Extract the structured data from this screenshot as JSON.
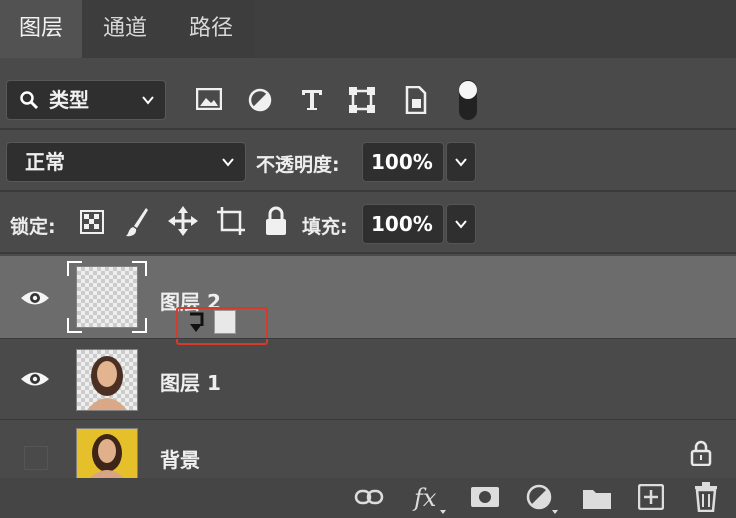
{
  "panel_tabs": [
    "图层",
    "通道",
    "路径"
  ],
  "filter": {
    "label": "类型"
  },
  "blend_mode": {
    "value": "正常"
  },
  "opacity": {
    "label": "不透明度:",
    "value": "100%"
  },
  "lock": {
    "label": "锁定:"
  },
  "fill": {
    "label": "填充:",
    "value": "100%"
  },
  "layers": [
    {
      "name": "图层 2",
      "visible": true,
      "selected": true,
      "thumbnail": "transparent-checker"
    },
    {
      "name": "图层 1",
      "visible": true,
      "selected": false,
      "thumbnail": "portrait-woman"
    },
    {
      "name": "背景",
      "visible": false,
      "selected": false,
      "locked": true,
      "thumbnail": "portrait-yellow-bg"
    }
  ],
  "filter_icons": [
    "image-filter-icon",
    "adjustment-filter-icon",
    "type-filter-icon",
    "shape-filter-icon",
    "smart-object-filter-icon",
    "filter-toggle-icon"
  ],
  "lock_icons": [
    "lock-transparent-pixels-icon",
    "lock-image-pixels-icon",
    "lock-position-icon",
    "lock-artboard-icon",
    "lock-all-icon"
  ],
  "bottom_icons": [
    "link-layers-icon",
    "fx-icon",
    "add-mask-icon",
    "new-adjustment-layer-icon",
    "new-group-icon",
    "new-layer-icon",
    "delete-layer-icon"
  ],
  "colors": {
    "panel_bg": "#4a4a4a",
    "selected_row": "#6c6c6c",
    "highlight_box": "#d63a2c"
  }
}
